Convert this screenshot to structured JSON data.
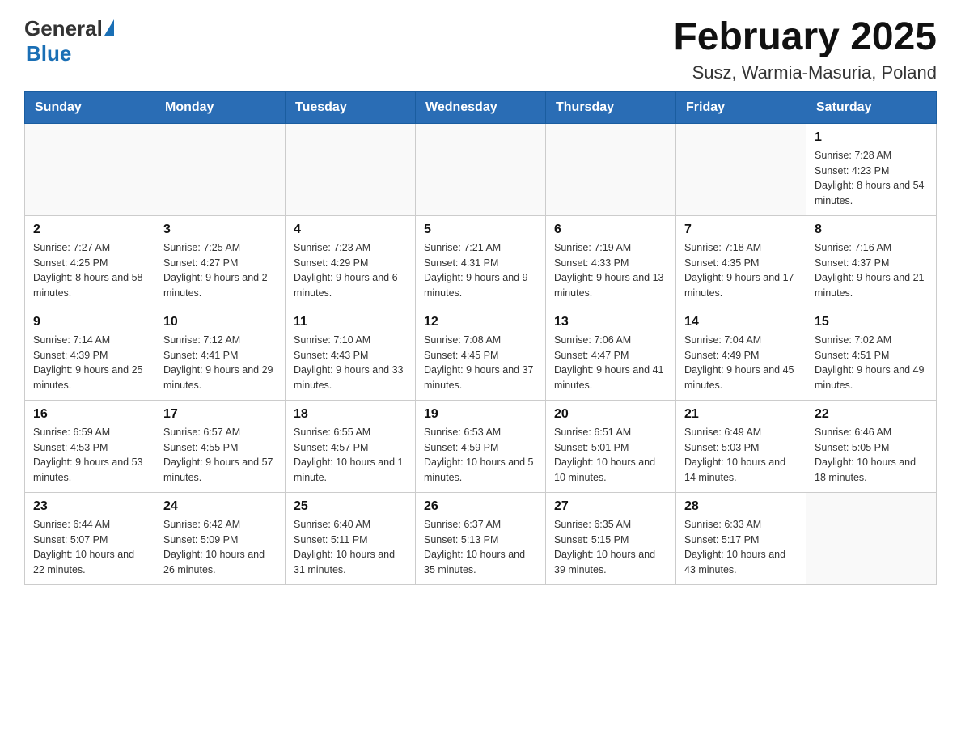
{
  "header": {
    "logo_general": "General",
    "logo_blue": "Blue",
    "title": "February 2025",
    "subtitle": "Susz, Warmia-Masuria, Poland"
  },
  "weekdays": [
    "Sunday",
    "Monday",
    "Tuesday",
    "Wednesday",
    "Thursday",
    "Friday",
    "Saturday"
  ],
  "weeks": [
    [
      {
        "day": "",
        "info": ""
      },
      {
        "day": "",
        "info": ""
      },
      {
        "day": "",
        "info": ""
      },
      {
        "day": "",
        "info": ""
      },
      {
        "day": "",
        "info": ""
      },
      {
        "day": "",
        "info": ""
      },
      {
        "day": "1",
        "info": "Sunrise: 7:28 AM\nSunset: 4:23 PM\nDaylight: 8 hours and 54 minutes."
      }
    ],
    [
      {
        "day": "2",
        "info": "Sunrise: 7:27 AM\nSunset: 4:25 PM\nDaylight: 8 hours and 58 minutes."
      },
      {
        "day": "3",
        "info": "Sunrise: 7:25 AM\nSunset: 4:27 PM\nDaylight: 9 hours and 2 minutes."
      },
      {
        "day": "4",
        "info": "Sunrise: 7:23 AM\nSunset: 4:29 PM\nDaylight: 9 hours and 6 minutes."
      },
      {
        "day": "5",
        "info": "Sunrise: 7:21 AM\nSunset: 4:31 PM\nDaylight: 9 hours and 9 minutes."
      },
      {
        "day": "6",
        "info": "Sunrise: 7:19 AM\nSunset: 4:33 PM\nDaylight: 9 hours and 13 minutes."
      },
      {
        "day": "7",
        "info": "Sunrise: 7:18 AM\nSunset: 4:35 PM\nDaylight: 9 hours and 17 minutes."
      },
      {
        "day": "8",
        "info": "Sunrise: 7:16 AM\nSunset: 4:37 PM\nDaylight: 9 hours and 21 minutes."
      }
    ],
    [
      {
        "day": "9",
        "info": "Sunrise: 7:14 AM\nSunset: 4:39 PM\nDaylight: 9 hours and 25 minutes."
      },
      {
        "day": "10",
        "info": "Sunrise: 7:12 AM\nSunset: 4:41 PM\nDaylight: 9 hours and 29 minutes."
      },
      {
        "day": "11",
        "info": "Sunrise: 7:10 AM\nSunset: 4:43 PM\nDaylight: 9 hours and 33 minutes."
      },
      {
        "day": "12",
        "info": "Sunrise: 7:08 AM\nSunset: 4:45 PM\nDaylight: 9 hours and 37 minutes."
      },
      {
        "day": "13",
        "info": "Sunrise: 7:06 AM\nSunset: 4:47 PM\nDaylight: 9 hours and 41 minutes."
      },
      {
        "day": "14",
        "info": "Sunrise: 7:04 AM\nSunset: 4:49 PM\nDaylight: 9 hours and 45 minutes."
      },
      {
        "day": "15",
        "info": "Sunrise: 7:02 AM\nSunset: 4:51 PM\nDaylight: 9 hours and 49 minutes."
      }
    ],
    [
      {
        "day": "16",
        "info": "Sunrise: 6:59 AM\nSunset: 4:53 PM\nDaylight: 9 hours and 53 minutes."
      },
      {
        "day": "17",
        "info": "Sunrise: 6:57 AM\nSunset: 4:55 PM\nDaylight: 9 hours and 57 minutes."
      },
      {
        "day": "18",
        "info": "Sunrise: 6:55 AM\nSunset: 4:57 PM\nDaylight: 10 hours and 1 minute."
      },
      {
        "day": "19",
        "info": "Sunrise: 6:53 AM\nSunset: 4:59 PM\nDaylight: 10 hours and 5 minutes."
      },
      {
        "day": "20",
        "info": "Sunrise: 6:51 AM\nSunset: 5:01 PM\nDaylight: 10 hours and 10 minutes."
      },
      {
        "day": "21",
        "info": "Sunrise: 6:49 AM\nSunset: 5:03 PM\nDaylight: 10 hours and 14 minutes."
      },
      {
        "day": "22",
        "info": "Sunrise: 6:46 AM\nSunset: 5:05 PM\nDaylight: 10 hours and 18 minutes."
      }
    ],
    [
      {
        "day": "23",
        "info": "Sunrise: 6:44 AM\nSunset: 5:07 PM\nDaylight: 10 hours and 22 minutes."
      },
      {
        "day": "24",
        "info": "Sunrise: 6:42 AM\nSunset: 5:09 PM\nDaylight: 10 hours and 26 minutes."
      },
      {
        "day": "25",
        "info": "Sunrise: 6:40 AM\nSunset: 5:11 PM\nDaylight: 10 hours and 31 minutes."
      },
      {
        "day": "26",
        "info": "Sunrise: 6:37 AM\nSunset: 5:13 PM\nDaylight: 10 hours and 35 minutes."
      },
      {
        "day": "27",
        "info": "Sunrise: 6:35 AM\nSunset: 5:15 PM\nDaylight: 10 hours and 39 minutes."
      },
      {
        "day": "28",
        "info": "Sunrise: 6:33 AM\nSunset: 5:17 PM\nDaylight: 10 hours and 43 minutes."
      },
      {
        "day": "",
        "info": ""
      }
    ]
  ]
}
